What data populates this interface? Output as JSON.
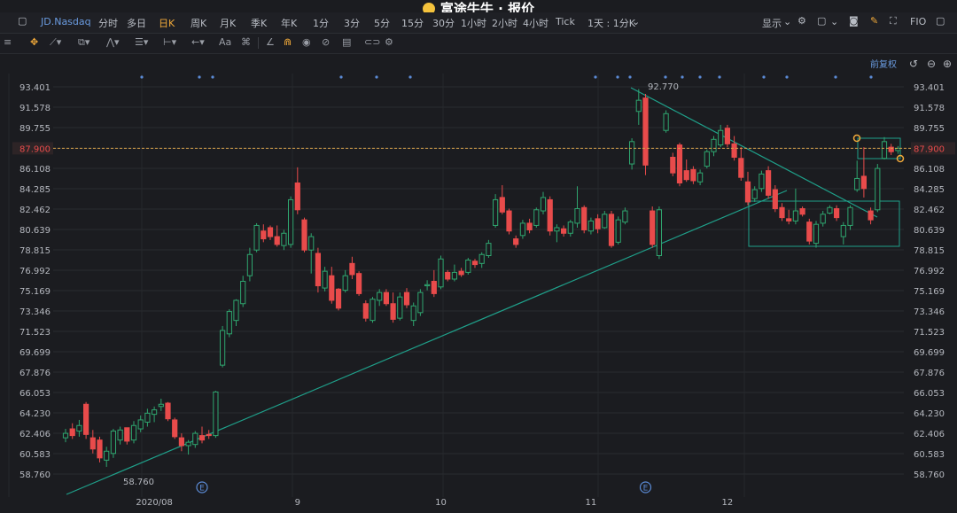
{
  "titlebar": {
    "title": "富途牛牛 · 报价"
  },
  "topbar": {
    "symbol": "JD.Nasdaq",
    "periods": [
      "分时",
      "多日",
      "日K",
      "周K",
      "月K",
      "季K",
      "年K",
      "1分",
      "3分",
      "5分",
      "15分",
      "30分",
      "1小时",
      "2小时",
      "4小时",
      "Tick",
      "1天 : 1分K"
    ],
    "active_period": "日K",
    "display_label": "显示",
    "fio_label": "FIO"
  },
  "toolbar": {
    "font_tool": "Aa",
    "rehab_label": "前复权"
  },
  "colors": {
    "background": "#1b1c20",
    "up": "#2fa66f",
    "down": "#e84b4b",
    "trendline": "#1fa08a",
    "current_price_line": "#d9a04a",
    "current_price_tag": "#e84b4b",
    "event_dot": "#5b8bd6"
  },
  "chart_data": {
    "type": "candlestick",
    "y_ticks": [
      "93.401",
      "91.578",
      "89.755",
      "87.900",
      "86.108",
      "84.285",
      "82.462",
      "80.639",
      "78.815",
      "76.992",
      "75.169",
      "73.346",
      "71.523",
      "69.699",
      "67.876",
      "66.053",
      "64.230",
      "62.406",
      "60.583",
      "58.760"
    ],
    "ylim": [
      58.76,
      93.401
    ],
    "current_price": "87.900",
    "high_label": "92.770",
    "low_label": "58.760",
    "x_labels": [
      {
        "label": "2020/08",
        "index": 13
      },
      {
        "label": "9",
        "index": 34
      },
      {
        "label": "10",
        "index": 55
      },
      {
        "label": "11",
        "index": 77
      },
      {
        "label": "12",
        "index": 97
      }
    ],
    "event_markers": [
      {
        "label": "E",
        "index": 20
      },
      {
        "label": "E",
        "index": 85
      }
    ],
    "candles": [
      {
        "o": 62.0,
        "h": 62.8,
        "l": 61.6,
        "c": 62.4
      },
      {
        "o": 62.8,
        "h": 63.3,
        "l": 61.9,
        "c": 62.2
      },
      {
        "o": 62.6,
        "h": 63.6,
        "l": 62.1,
        "c": 63.1
      },
      {
        "o": 65.0,
        "h": 65.2,
        "l": 61.9,
        "c": 62.3
      },
      {
        "o": 62.0,
        "h": 62.7,
        "l": 60.6,
        "c": 61.0
      },
      {
        "o": 61.8,
        "h": 62.1,
        "l": 59.8,
        "c": 60.2
      },
      {
        "o": 60.0,
        "h": 61.2,
        "l": 59.4,
        "c": 60.8
      },
      {
        "o": 60.6,
        "h": 62.8,
        "l": 60.2,
        "c": 62.6
      },
      {
        "o": 61.8,
        "h": 63.0,
        "l": 61.4,
        "c": 62.7
      },
      {
        "o": 62.9,
        "h": 62.9,
        "l": 61.4,
        "c": 61.7
      },
      {
        "o": 61.8,
        "h": 63.5,
        "l": 61.5,
        "c": 63.1
      },
      {
        "o": 62.8,
        "h": 64.0,
        "l": 62.5,
        "c": 63.6
      },
      {
        "o": 63.4,
        "h": 64.6,
        "l": 63.0,
        "c": 64.2
      },
      {
        "o": 64.1,
        "h": 64.8,
        "l": 63.4,
        "c": 64.5
      },
      {
        "o": 64.8,
        "h": 65.5,
        "l": 64.4,
        "c": 65.0
      },
      {
        "o": 65.1,
        "h": 65.2,
        "l": 63.5,
        "c": 63.7
      },
      {
        "o": 63.6,
        "h": 63.8,
        "l": 61.9,
        "c": 62.1
      },
      {
        "o": 62.0,
        "h": 62.4,
        "l": 60.8,
        "c": 61.3
      },
      {
        "o": 61.3,
        "h": 61.8,
        "l": 60.5,
        "c": 61.6
      },
      {
        "o": 61.4,
        "h": 62.6,
        "l": 61.1,
        "c": 62.4
      },
      {
        "o": 62.2,
        "h": 63.0,
        "l": 61.5,
        "c": 61.8
      },
      {
        "o": 62.3,
        "h": 62.7,
        "l": 61.9,
        "c": 62.2
      },
      {
        "o": 62.2,
        "h": 66.2,
        "l": 62.0,
        "c": 66.1
      },
      {
        "o": 68.5,
        "h": 72.0,
        "l": 68.3,
        "c": 71.6
      },
      {
        "o": 71.3,
        "h": 73.5,
        "l": 71.0,
        "c": 73.3
      },
      {
        "o": 72.5,
        "h": 74.4,
        "l": 72.0,
        "c": 74.3
      },
      {
        "o": 74.0,
        "h": 76.5,
        "l": 73.7,
        "c": 76.0
      },
      {
        "o": 76.5,
        "h": 79.0,
        "l": 76.0,
        "c": 78.4
      },
      {
        "o": 78.8,
        "h": 81.2,
        "l": 78.6,
        "c": 81.0
      },
      {
        "o": 80.5,
        "h": 81.1,
        "l": 79.5,
        "c": 79.8
      },
      {
        "o": 80.8,
        "h": 81.0,
        "l": 79.7,
        "c": 80.0
      },
      {
        "o": 80.0,
        "h": 81.0,
        "l": 79.1,
        "c": 79.3
      },
      {
        "o": 79.2,
        "h": 80.6,
        "l": 78.8,
        "c": 80.3
      },
      {
        "o": 79.3,
        "h": 83.6,
        "l": 79.0,
        "c": 83.3
      },
      {
        "o": 84.8,
        "h": 86.2,
        "l": 82.0,
        "c": 82.4
      },
      {
        "o": 81.5,
        "h": 81.7,
        "l": 78.6,
        "c": 78.8
      },
      {
        "o": 78.8,
        "h": 80.3,
        "l": 76.7,
        "c": 80.0
      },
      {
        "o": 78.5,
        "h": 79.0,
        "l": 75.0,
        "c": 75.6
      },
      {
        "o": 75.4,
        "h": 77.3,
        "l": 75.1,
        "c": 76.9
      },
      {
        "o": 76.5,
        "h": 77.3,
        "l": 74.0,
        "c": 74.3
      },
      {
        "o": 75.3,
        "h": 75.4,
        "l": 73.4,
        "c": 73.6
      },
      {
        "o": 75.2,
        "h": 77.0,
        "l": 75.0,
        "c": 76.5
      },
      {
        "o": 77.6,
        "h": 78.2,
        "l": 76.2,
        "c": 76.6
      },
      {
        "o": 76.7,
        "h": 76.9,
        "l": 74.7,
        "c": 74.9
      },
      {
        "o": 74.0,
        "h": 74.3,
        "l": 72.4,
        "c": 72.7
      },
      {
        "o": 72.5,
        "h": 74.6,
        "l": 72.3,
        "c": 74.4
      },
      {
        "o": 74.3,
        "h": 75.3,
        "l": 73.8,
        "c": 75.0
      },
      {
        "o": 75.0,
        "h": 75.3,
        "l": 73.8,
        "c": 74.0
      },
      {
        "o": 74.0,
        "h": 75.0,
        "l": 72.3,
        "c": 72.6
      },
      {
        "o": 72.7,
        "h": 75.0,
        "l": 72.5,
        "c": 74.6
      },
      {
        "o": 75.0,
        "h": 75.4,
        "l": 73.6,
        "c": 73.9
      },
      {
        "o": 72.5,
        "h": 74.1,
        "l": 72.0,
        "c": 73.8
      },
      {
        "o": 73.2,
        "h": 75.3,
        "l": 72.9,
        "c": 75.0
      },
      {
        "o": 75.6,
        "h": 76.1,
        "l": 75.2,
        "c": 75.7
      },
      {
        "o": 76.0,
        "h": 77.0,
        "l": 74.6,
        "c": 74.9
      },
      {
        "o": 75.5,
        "h": 78.3,
        "l": 75.3,
        "c": 78.0
      },
      {
        "o": 76.8,
        "h": 77.0,
        "l": 76.0,
        "c": 76.2
      },
      {
        "o": 76.2,
        "h": 77.5,
        "l": 76.0,
        "c": 76.8
      },
      {
        "o": 76.9,
        "h": 77.2,
        "l": 76.4,
        "c": 76.6
      },
      {
        "o": 76.8,
        "h": 78.1,
        "l": 76.6,
        "c": 77.9
      },
      {
        "o": 77.8,
        "h": 78.0,
        "l": 77.2,
        "c": 77.5
      },
      {
        "o": 77.6,
        "h": 78.6,
        "l": 77.2,
        "c": 78.4
      },
      {
        "o": 78.3,
        "h": 79.7,
        "l": 78.1,
        "c": 79.4
      },
      {
        "o": 81.0,
        "h": 83.8,
        "l": 80.8,
        "c": 83.3
      },
      {
        "o": 83.5,
        "h": 84.6,
        "l": 82.0,
        "c": 82.2
      },
      {
        "o": 82.3,
        "h": 82.5,
        "l": 80.2,
        "c": 80.5
      },
      {
        "o": 79.8,
        "h": 80.1,
        "l": 79.0,
        "c": 79.3
      },
      {
        "o": 80.1,
        "h": 81.5,
        "l": 79.8,
        "c": 81.2
      },
      {
        "o": 81.2,
        "h": 81.6,
        "l": 80.3,
        "c": 80.6
      },
      {
        "o": 81.0,
        "h": 82.6,
        "l": 80.8,
        "c": 82.4
      },
      {
        "o": 82.3,
        "h": 84.0,
        "l": 82.0,
        "c": 83.5
      },
      {
        "o": 83.3,
        "h": 83.6,
        "l": 80.1,
        "c": 80.5
      },
      {
        "o": 80.5,
        "h": 81.1,
        "l": 79.5,
        "c": 80.8
      },
      {
        "o": 80.7,
        "h": 81.0,
        "l": 80.0,
        "c": 80.3
      },
      {
        "o": 80.3,
        "h": 81.5,
        "l": 80.0,
        "c": 81.3
      },
      {
        "o": 81.2,
        "h": 84.5,
        "l": 80.8,
        "c": 82.5
      },
      {
        "o": 82.6,
        "h": 82.8,
        "l": 80.3,
        "c": 80.6
      },
      {
        "o": 80.5,
        "h": 81.7,
        "l": 80.2,
        "c": 81.4
      },
      {
        "o": 81.6,
        "h": 82.0,
        "l": 80.3,
        "c": 80.7
      },
      {
        "o": 80.8,
        "h": 82.3,
        "l": 80.7,
        "c": 82.0
      },
      {
        "o": 82.0,
        "h": 82.3,
        "l": 79.0,
        "c": 79.2
      },
      {
        "o": 79.5,
        "h": 81.8,
        "l": 79.3,
        "c": 81.5
      },
      {
        "o": 81.3,
        "h": 82.6,
        "l": 81.1,
        "c": 82.3
      },
      {
        "o": 86.5,
        "h": 88.8,
        "l": 86.0,
        "c": 88.5
      },
      {
        "o": 91.2,
        "h": 93.2,
        "l": 90.0,
        "c": 92.2
      },
      {
        "o": 92.4,
        "h": 92.77,
        "l": 85.5,
        "c": 86.4
      },
      {
        "o": 82.3,
        "h": 82.7,
        "l": 79.0,
        "c": 79.3
      },
      {
        "o": 78.3,
        "h": 82.7,
        "l": 78.0,
        "c": 82.4
      },
      {
        "o": 89.5,
        "h": 91.3,
        "l": 89.3,
        "c": 91.0
      },
      {
        "o": 87.1,
        "h": 87.5,
        "l": 85.4,
        "c": 85.7
      },
      {
        "o": 88.2,
        "h": 88.4,
        "l": 84.5,
        "c": 84.8
      },
      {
        "o": 85.9,
        "h": 86.9,
        "l": 84.9,
        "c": 85.1
      },
      {
        "o": 86.0,
        "h": 86.3,
        "l": 84.7,
        "c": 85.0
      },
      {
        "o": 84.9,
        "h": 86.0,
        "l": 84.6,
        "c": 85.7
      },
      {
        "o": 86.3,
        "h": 87.8,
        "l": 86.1,
        "c": 87.6
      },
      {
        "o": 87.6,
        "h": 89.0,
        "l": 87.2,
        "c": 88.7
      },
      {
        "o": 88.2,
        "h": 90.0,
        "l": 88.0,
        "c": 89.5
      },
      {
        "o": 89.7,
        "h": 90.0,
        "l": 88.0,
        "c": 88.3
      },
      {
        "o": 88.3,
        "h": 89.0,
        "l": 86.8,
        "c": 87.1
      },
      {
        "o": 87.0,
        "h": 88.0,
        "l": 85.0,
        "c": 85.3
      },
      {
        "o": 84.9,
        "h": 85.8,
        "l": 82.8,
        "c": 83.1
      },
      {
        "o": 83.4,
        "h": 84.5,
        "l": 83.1,
        "c": 84.2
      },
      {
        "o": 84.3,
        "h": 85.9,
        "l": 84.0,
        "c": 85.6
      },
      {
        "o": 85.9,
        "h": 86.3,
        "l": 83.4,
        "c": 83.7
      },
      {
        "o": 84.2,
        "h": 84.6,
        "l": 82.2,
        "c": 82.5
      },
      {
        "o": 82.6,
        "h": 83.0,
        "l": 81.4,
        "c": 81.7
      },
      {
        "o": 81.6,
        "h": 82.4,
        "l": 81.1,
        "c": 81.4
      },
      {
        "o": 81.4,
        "h": 84.3,
        "l": 81.1,
        "c": 82.3
      },
      {
        "o": 82.5,
        "h": 82.7,
        "l": 81.8,
        "c": 82.0
      },
      {
        "o": 81.3,
        "h": 81.6,
        "l": 79.3,
        "c": 79.6
      },
      {
        "o": 79.4,
        "h": 81.4,
        "l": 79.0,
        "c": 81.1
      },
      {
        "o": 81.2,
        "h": 82.3,
        "l": 80.9,
        "c": 82.0
      },
      {
        "o": 82.1,
        "h": 82.8,
        "l": 82.0,
        "c": 82.6
      },
      {
        "o": 82.5,
        "h": 82.8,
        "l": 81.4,
        "c": 81.7
      },
      {
        "o": 80.0,
        "h": 81.3,
        "l": 79.3,
        "c": 81.0
      },
      {
        "o": 81.0,
        "h": 82.8,
        "l": 80.6,
        "c": 82.6
      },
      {
        "o": 84.2,
        "h": 86.8,
        "l": 84.0,
        "c": 85.2
      },
      {
        "o": 85.4,
        "h": 88.0,
        "l": 83.5,
        "c": 84.3
      },
      {
        "o": 82.3,
        "h": 82.6,
        "l": 81.1,
        "c": 81.5
      },
      {
        "o": 82.4,
        "h": 86.5,
        "l": 82.2,
        "c": 86.1
      },
      {
        "o": 87.0,
        "h": 88.9,
        "l": 86.9,
        "c": 88.5
      },
      {
        "o": 88.0,
        "h": 88.3,
        "l": 87.3,
        "c": 87.6
      },
      {
        "o": 87.7,
        "h": 88.1,
        "l": 87.4,
        "c": 87.9
      }
    ]
  }
}
